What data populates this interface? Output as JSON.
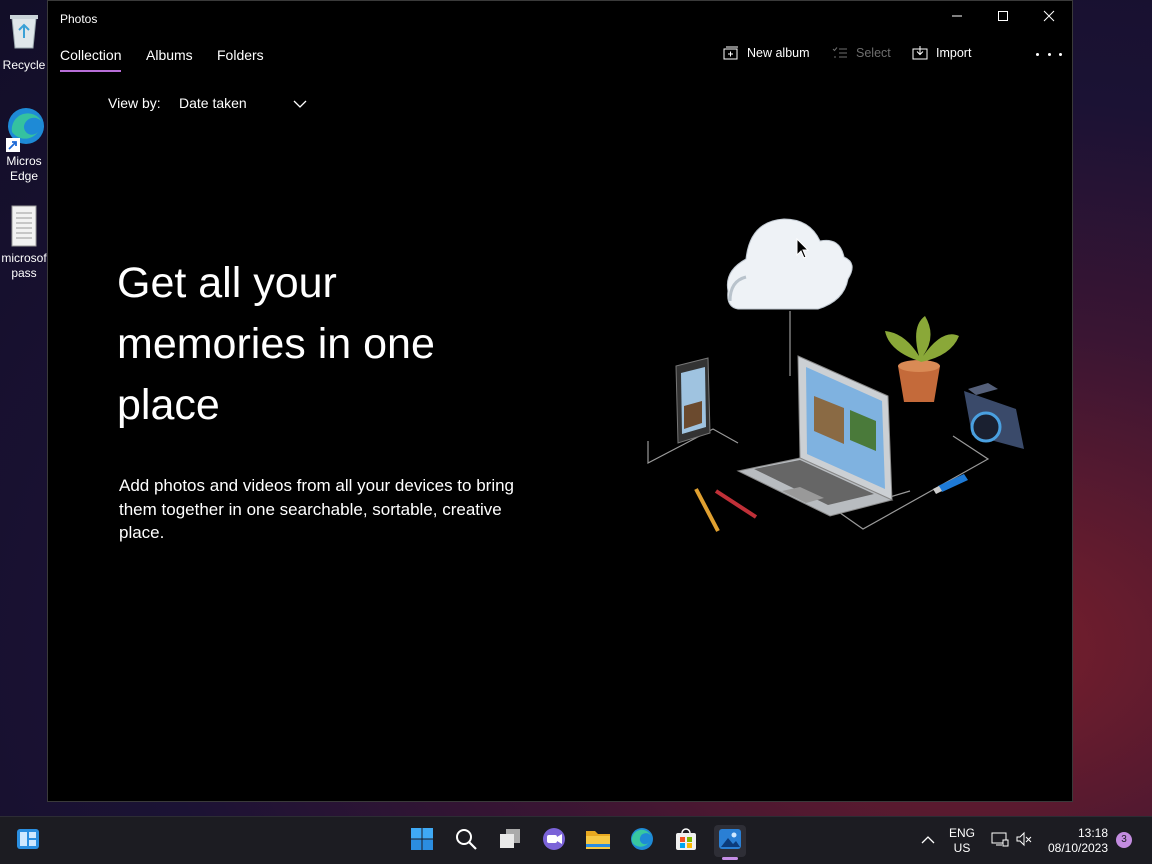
{
  "desktop": {
    "icons": [
      {
        "label": "Recycle",
        "icon": "recycle-bin-icon"
      },
      {
        "label": "Micros Edge",
        "icon": "edge-shortcut-icon"
      },
      {
        "label": "microsof pass",
        "icon": "text-file-icon"
      }
    ]
  },
  "window": {
    "title": "Photos",
    "controls": {
      "minimize": "minimize-icon",
      "maximize": "maximize-icon",
      "close": "close-icon"
    }
  },
  "nav": {
    "tabs": [
      {
        "label": "Collection",
        "active": true
      },
      {
        "label": "Albums",
        "active": false
      },
      {
        "label": "Folders",
        "active": false
      }
    ]
  },
  "commands": {
    "new_album": "New album",
    "select": "Select",
    "import": "Import"
  },
  "view_by": {
    "label": "View by:",
    "selected": "Date taken"
  },
  "hero": {
    "headline": "Get all your memories in one place",
    "subtext": "Add photos and videos from all your devices to bring them together in one searchable, sortable, creative place."
  },
  "illustration": {
    "icon": "devices-cloud-illustration"
  },
  "taskbar": {
    "apps": [
      "start-icon",
      "search-icon",
      "task-view-icon",
      "chat-icon",
      "file-explorer-icon",
      "edge-icon",
      "store-icon",
      "photos-icon"
    ],
    "language": {
      "line1": "ENG",
      "line2": "US"
    },
    "time": "13:18",
    "date": "08/10/2023",
    "notification_count": "3"
  },
  "colors": {
    "accent": "#b86ed8",
    "window_bg": "#000000",
    "taskbar_bg": "#1c1c22"
  }
}
